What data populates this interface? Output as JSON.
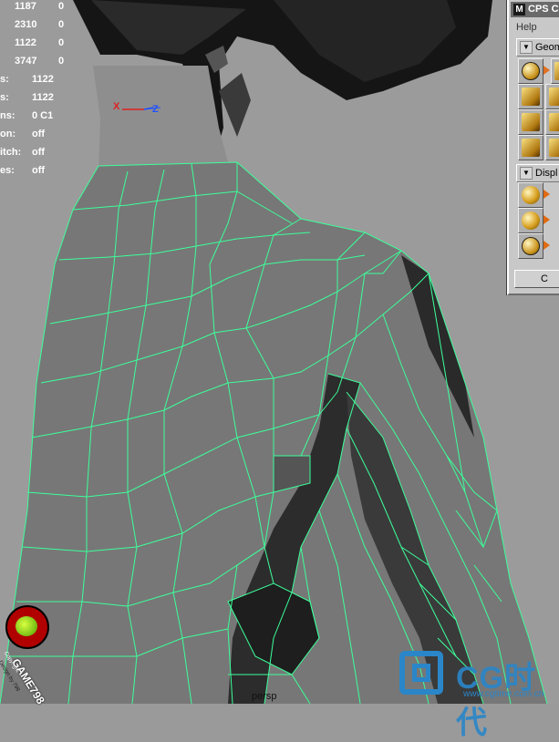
{
  "hud": {
    "poly_rows": [
      {
        "value": "1187",
        "selected": "0"
      },
      {
        "value": "2310",
        "selected": "0"
      },
      {
        "value": "1122",
        "selected": "0"
      },
      {
        "value": "3747",
        "selected": "0"
      }
    ],
    "info_rows": [
      {
        "label": "s:",
        "value": "1122"
      },
      {
        "label": "s:",
        "value": "1122"
      },
      {
        "label": "ns:",
        "value": "0 C1"
      },
      {
        "label": "on:",
        "value": "off"
      },
      {
        "label": "itch:",
        "value": "off"
      },
      {
        "label": "es:",
        "value": "off"
      }
    ]
  },
  "axis": {
    "x_label": "X",
    "z_label": "Z",
    "x_color": "#e02020",
    "z_color": "#2050ff"
  },
  "viewport": {
    "camera": "persp",
    "wire_color": "#3cff9a",
    "mesh_color": "#7a7a7a"
  },
  "cps_window": {
    "title": "CPS C",
    "menu_help": "Help",
    "section_geom": "Geom",
    "section_display": "Displ",
    "footer_button": "C"
  },
  "logos": {
    "game_brand": "GAME798",
    "game_copy1": "Copyright",
    "game_copy2": "Design by 798",
    "cg_text": "CG时代",
    "cg_url": "www.cgtime.com.cn"
  }
}
